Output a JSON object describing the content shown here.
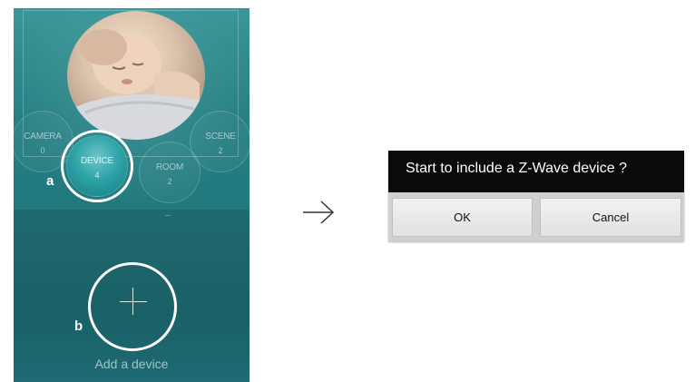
{
  "phone": {
    "modes": [
      {
        "label": "CAMERA",
        "count": "0"
      },
      {
        "label": "SCENE",
        "count": "2"
      },
      {
        "label": "ROOM",
        "count": "2"
      },
      {
        "label": "DEVICE",
        "count": "4"
      }
    ],
    "add_label": "Add a device",
    "photo_icon": "sleeping-baby-photo"
  },
  "markers": {
    "a": "a",
    "b": "b"
  },
  "arrow_icon": "right-arrow",
  "dialog": {
    "title": "Start to include a Z-Wave device ?",
    "ok_label": "OK",
    "cancel_label": "Cancel"
  },
  "colors": {
    "phone_teal": "#1f7478",
    "dialog_title_bg": "#0b0b0b",
    "dialog_bg": "#cfcfcf"
  }
}
